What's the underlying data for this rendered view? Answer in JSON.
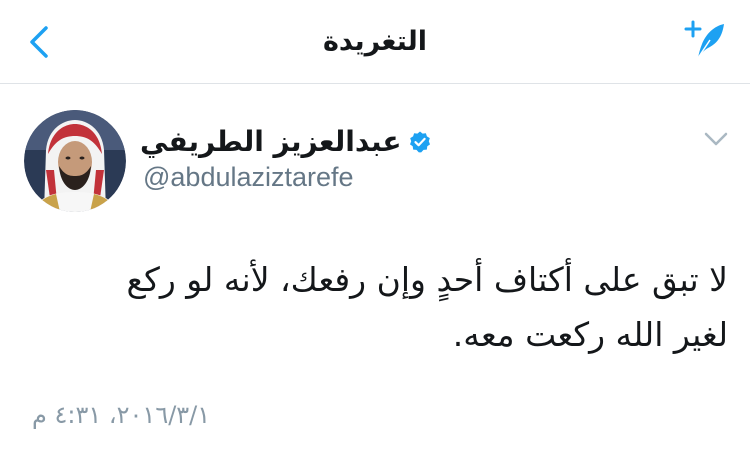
{
  "header": {
    "title": "التغريدة",
    "back_icon": "chevron-left-icon",
    "compose_icon": "compose-tweet-icon",
    "accent_color": "#1da1f2"
  },
  "tweet": {
    "author": {
      "display_name": "عبدالعزيز الطريفي",
      "handle": "@abdulaziztarefe",
      "verified": true
    },
    "text_lines": [
      "لا تبق على أكتاف أحدٍ وإن رفعك، لأنه لو ركع",
      "لغير الله ركعت معه."
    ],
    "timestamp": "٢٠١٦/٣/١، ٤:٣١ م"
  },
  "colors": {
    "text": "#14171a",
    "secondary": "#657786",
    "timestamp": "#8899a6",
    "divider": "#dfe3e7"
  }
}
